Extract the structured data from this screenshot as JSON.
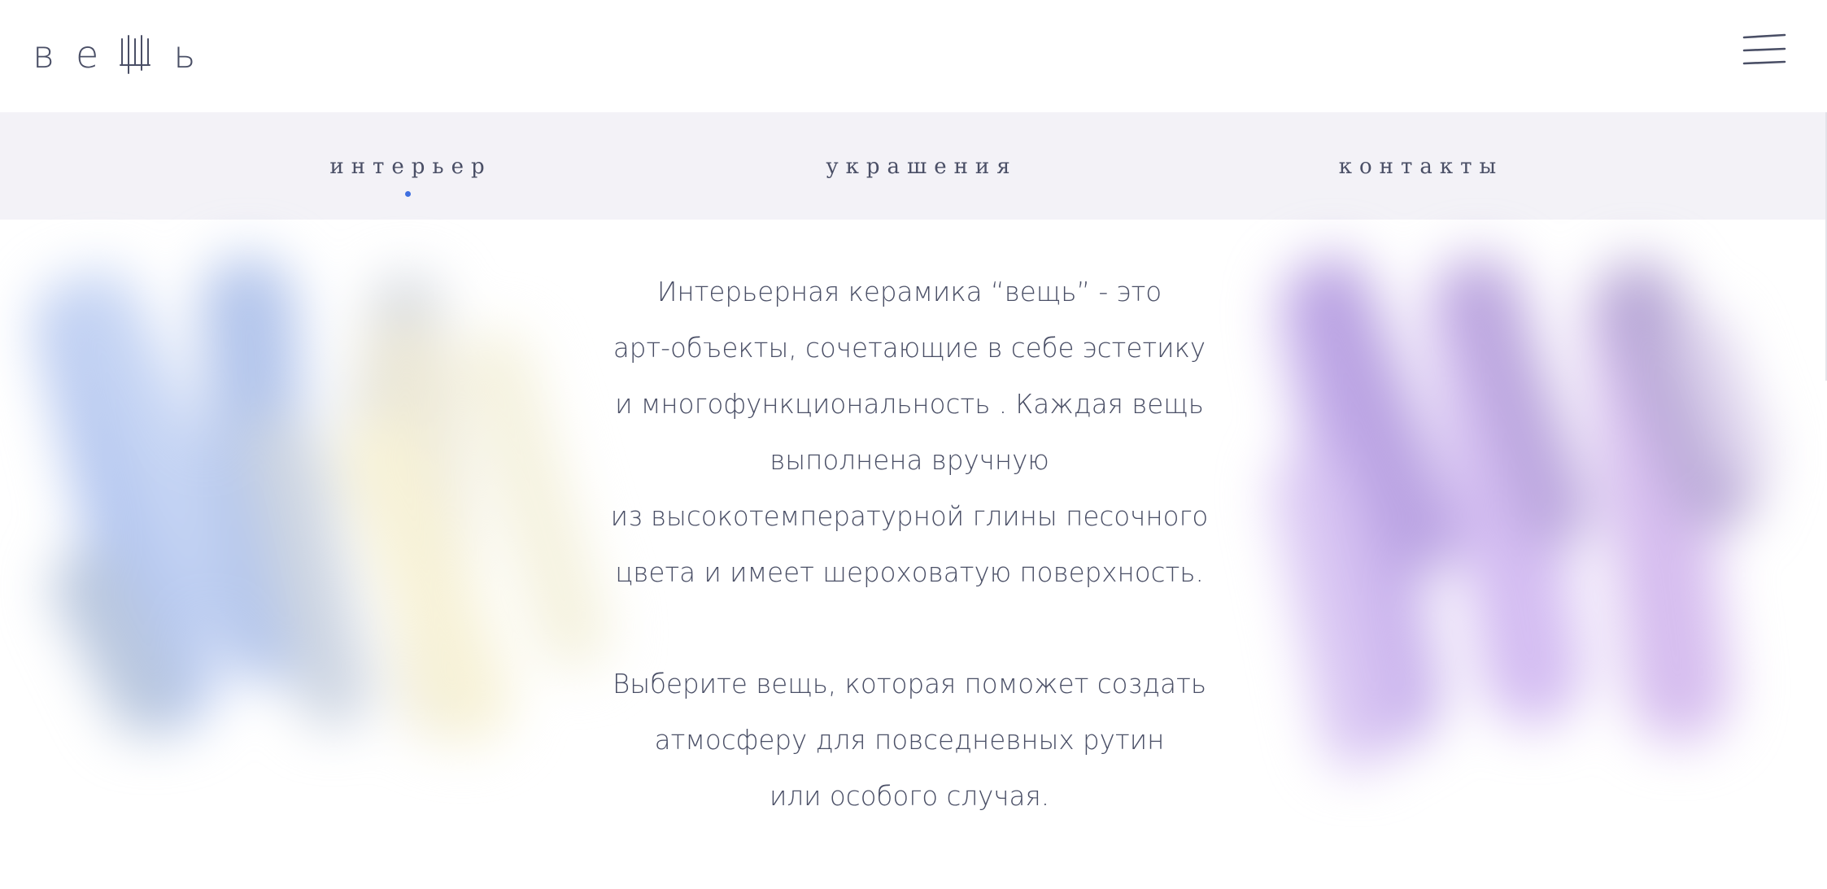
{
  "header": {
    "logo_letters": [
      "в",
      "е",
      "ь"
    ],
    "logo_text": "вещь",
    "menu_icon": "hamburger-menu-icon"
  },
  "nav": {
    "items": [
      {
        "label": "интерьер",
        "active": true
      },
      {
        "label": "украшения",
        "active": false
      },
      {
        "label": "контакты",
        "active": false
      }
    ],
    "active_indicator_color": "#3f6fe0"
  },
  "description": {
    "paragraph1": [
      "Интерьерная керамика “вещь” - это",
      "арт-объекты, сочетающие в себе эстетику",
      "и многофункциональность . Каждая вещь",
      "выполнена вручную",
      "из высокотемпературной глины песочного",
      "цвета и имеет шероховатую поверхность."
    ],
    "paragraph2": [
      "Выберите вещь, которая поможет создать",
      "атмосферу для повседневных рутин",
      "или особого случая."
    ]
  },
  "colors": {
    "text": "#4a4f66",
    "nav_background": "#f3f2f7",
    "accent": "#3f6fe0",
    "art_left_blue": "#b9c9ef",
    "art_left_yellow": "#f6f1d6",
    "art_right_violet": "#cfb6ef"
  }
}
